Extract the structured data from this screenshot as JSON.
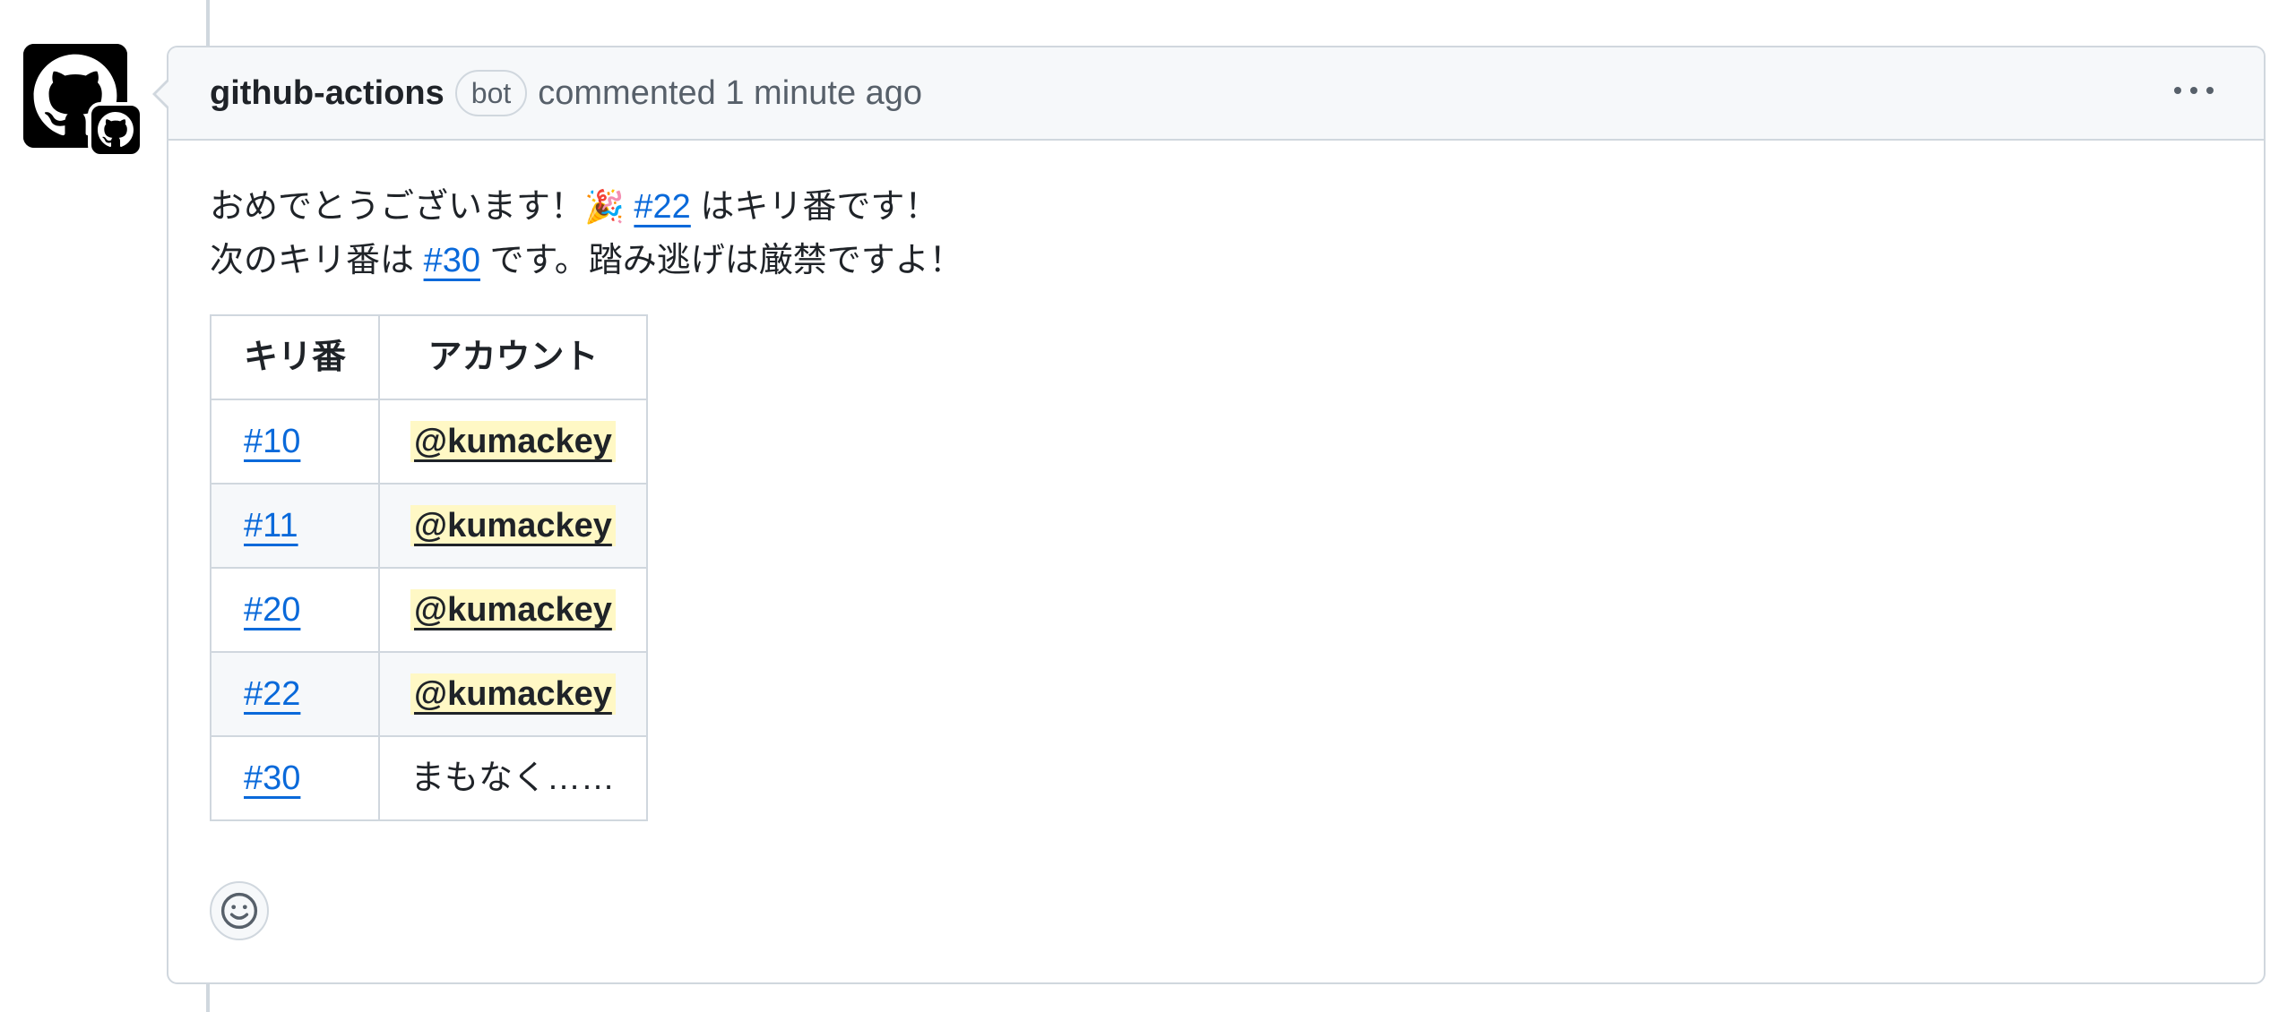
{
  "comment": {
    "author": "github-actions",
    "badge": "bot",
    "meta": "commented 1 minute ago",
    "body": {
      "line1_pre": "おめでとうございます！",
      "line1_emoji": "🎉",
      "line1_ref": "#22",
      "line1_post": " はキリ番です！",
      "line2_pre": "次のキリ番は ",
      "line2_ref": "#30",
      "line2_post": " です。踏み逃げは厳禁ですよ！"
    },
    "table": {
      "headers": [
        "キリ番",
        "アカウント"
      ],
      "rows": [
        {
          "number": "#10",
          "account": "@kumackey"
        },
        {
          "number": "#11",
          "account": "@kumackey"
        },
        {
          "number": "#20",
          "account": "@kumackey"
        },
        {
          "number": "#22",
          "account": "@kumackey"
        },
        {
          "number": "#30",
          "account": "まもなく……"
        }
      ]
    }
  },
  "icons": {
    "avatar": "github-mark-icon",
    "badge": "github-mark-icon",
    "menu": "kebab-horizontal-icon",
    "reaction": "smiley-icon"
  },
  "colors": {
    "link": "#0969da",
    "mention_bg": "#fff8c5",
    "border": "#d0d7de",
    "header_bg": "#f6f8fa"
  }
}
